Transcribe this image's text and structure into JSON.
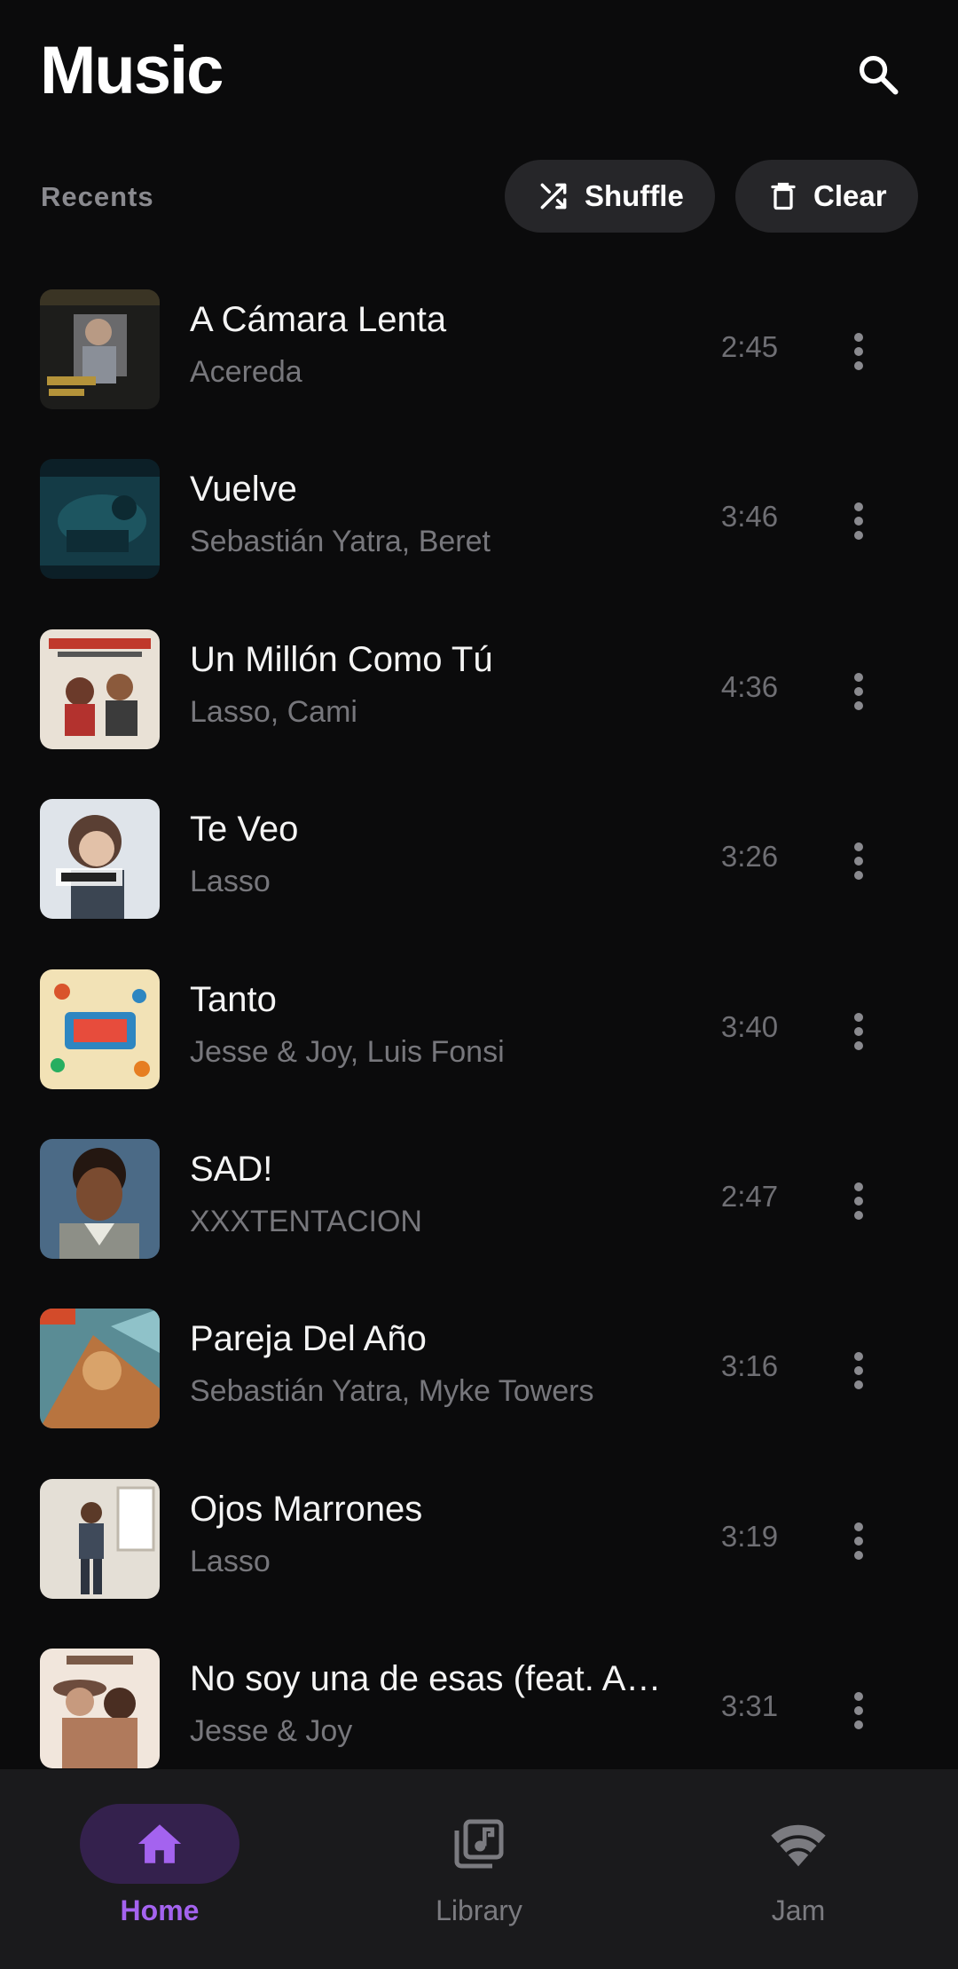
{
  "header": {
    "title": "Music",
    "search_icon": "search-icon"
  },
  "recents": {
    "label": "Recents",
    "shuffle_label": "Shuffle",
    "clear_label": "Clear"
  },
  "songs": [
    {
      "title": "A Cámara Lenta",
      "artist": "Acereda",
      "duration": "2:45"
    },
    {
      "title": "Vuelve",
      "artist": "Sebastián Yatra, Beret",
      "duration": "3:46"
    },
    {
      "title": "Un Millón Como Tú",
      "artist": "Lasso, Cami",
      "duration": "4:36"
    },
    {
      "title": "Te Veo",
      "artist": "Lasso",
      "duration": "3:26"
    },
    {
      "title": "Tanto",
      "artist": "Jesse & Joy, Luis Fonsi",
      "duration": "3:40"
    },
    {
      "title": "SAD!",
      "artist": "XXXTENTACION",
      "duration": "2:47"
    },
    {
      "title": "Pareja Del Año",
      "artist": "Sebastián Yatra, Myke Towers",
      "duration": "3:16"
    },
    {
      "title": "Ojos Marrones",
      "artist": "Lasso",
      "duration": "3:19"
    },
    {
      "title": "No soy una de esas (feat. A…",
      "artist": "Jesse & Joy",
      "duration": "3:31"
    }
  ],
  "nav": {
    "items": [
      {
        "label": "Home",
        "icon": "home-icon",
        "active": true
      },
      {
        "label": "Library",
        "icon": "library-music-icon",
        "active": false
      },
      {
        "label": "Jam",
        "icon": "wifi-icon",
        "active": false
      }
    ]
  },
  "colors": {
    "background": "#0b0b0c",
    "chip": "#262629",
    "accent": "#a463ef",
    "accent_pill": "#34214d",
    "nav_background": "#1a1a1c"
  }
}
